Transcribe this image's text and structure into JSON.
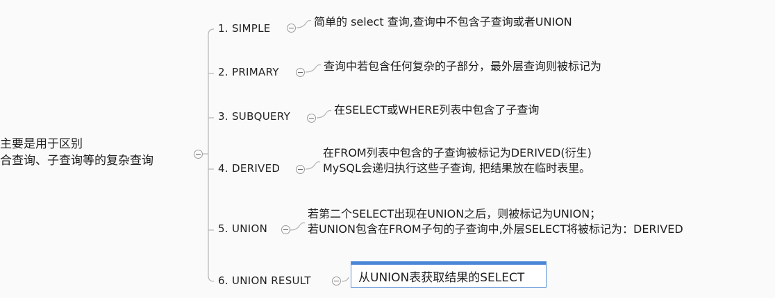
{
  "root": {
    "lines": [
      "主要是用于区别",
      "合查询、子查询等的复杂查询"
    ]
  },
  "items": [
    {
      "label": "1. SIMPLE",
      "desc": [
        "简单的 select 查询,查询中不包含子查询或者UNION"
      ]
    },
    {
      "label": "2. PRIMARY",
      "desc": [
        "查询中若包含任何复杂的子部分，最外层查询则被标记为"
      ]
    },
    {
      "label": "3. SUBQUERY",
      "desc": [
        "在SELECT或WHERE列表中包含了子查询"
      ]
    },
    {
      "label": "4. DERIVED",
      "desc": [
        "在FROM列表中包含的子查询被标记为DERIVED(衍生)",
        "MySQL会递归执行这些子查询, 把结果放在临时表里。"
      ]
    },
    {
      "label": "5. UNION",
      "desc": [
        "若第二个SELECT出现在UNION之后，则被标记为UNION；",
        "若UNION包含在FROM子句的子查询中,外层SELECT将被标记为：DERIVED"
      ]
    },
    {
      "label": "6. UNION RESULT",
      "desc": [
        "从UNION表获取结果的SELECT"
      ]
    }
  ],
  "colors": {
    "connector": "#b5b5b5",
    "selection": "#4a86d6",
    "text": "#1e1e1e"
  }
}
